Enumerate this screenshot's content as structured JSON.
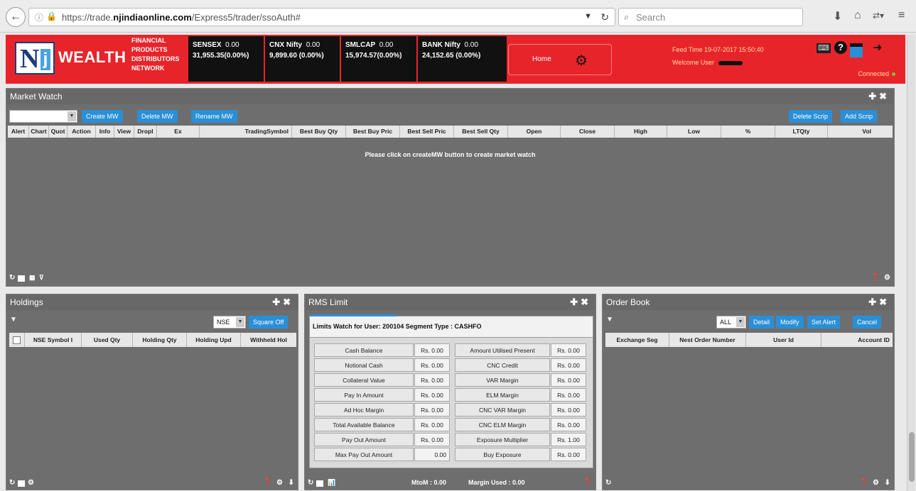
{
  "browser": {
    "url_prefix": "https://trade.",
    "url_domain": "njindiaonline.com",
    "url_path": "/Express5/trader/ssoAuth#",
    "search_placeholder": "Search"
  },
  "header": {
    "logo_letter": "N",
    "logo_j": "j",
    "brand": "WEALTH",
    "tagline": [
      "FINANCIAL",
      "PRODUCTS",
      "DISTRIBUTORS",
      "NETWORK"
    ],
    "indices": [
      {
        "name": "SENSEX",
        "change": "0.00",
        "value": "31,955.35(0.00%)"
      },
      {
        "name": "CNX Nifty",
        "change": "0.00",
        "value": "9,899.60 (0.00%)"
      },
      {
        "name": "SMLCAP",
        "change": "0.00",
        "value": "15,974.57(0.00%)"
      },
      {
        "name": "BANK Nifty",
        "change": "0.00",
        "value": "24,152.65 (0.00%)"
      }
    ],
    "home_label": "Home",
    "feed_time": "Feed Time 19-07-2017 15:50:40",
    "welcome": "Welcome User",
    "connected": "Connected"
  },
  "market_watch": {
    "title": "Market Watch",
    "buttons": {
      "create": "Create MW",
      "delete": "Delete MW",
      "rename": "Rename MW",
      "delete_scrip": "Delete Scrip",
      "add_scrip": "Add Scrip"
    },
    "columns": [
      "Alert",
      "Chart",
      "Quot",
      "Action",
      "Info",
      "View",
      "Dropl",
      "Ex",
      "TradingSymbol",
      "Best Buy Qty",
      "Best Buy Pric",
      "Best Sell Pric",
      "Best Sell Qty",
      "Open",
      "Close",
      "High",
      "Low",
      "%",
      "LTQty",
      "Vol"
    ],
    "message": "Please click on createMW button to create market watch"
  },
  "holdings": {
    "title": "Holdings",
    "exchange": "NSE",
    "square_off": "Square Off",
    "columns": [
      "NSE Symbol I",
      "Used Qty",
      "Holding Qty",
      "Holding Upd",
      "Withheld Hol"
    ]
  },
  "rms": {
    "title": "RMS Limit",
    "header": "Limits Watch for User: 200104 Segment Type : CASHFO",
    "rows": [
      [
        "Cash Balance",
        "Rs. 0.00",
        "Amount Utilised Present",
        "Rs. 0.00"
      ],
      [
        "Notional Cash",
        "Rs. 0.00",
        "CNC Credit",
        "Rs. 0.00"
      ],
      [
        "Collateral Value",
        "Rs. 0.00",
        "VAR Margin",
        "Rs. 0.00"
      ],
      [
        "Pay In Amount",
        "Rs. 0.00",
        "ELM Margin",
        "Rs. 0.00"
      ],
      [
        "Ad Hoc Margin",
        "Rs. 0.00",
        "CNC VAR Margin",
        "Rs. 0.00"
      ],
      [
        "Total Available Balance",
        "Rs. 0.00",
        "CNC ELM Margin",
        "Rs. 0.00"
      ],
      [
        "Pay Out Amount",
        "Rs. 0.00",
        "Exposure Multiplier",
        "Rs. 1.00"
      ],
      [
        "Max Pay Out Amount",
        "0.00",
        "Buy Exposure",
        "Rs. 0.00"
      ]
    ],
    "mtom": "MtoM : 0.00",
    "margin_used": "Margin Used : 0.00"
  },
  "order_book": {
    "title": "Order Book",
    "filter": "ALL",
    "buttons": {
      "detail": "Detail",
      "modify": "Modify",
      "set_alert": "Set Alert",
      "cancel": "Cancel"
    },
    "columns": [
      "Exchange Seg",
      "Nest Order Number",
      "User Id",
      "Account ID"
    ]
  },
  "colors": {
    "header_red": "#e8242b",
    "button_blue": "#2a8fd6",
    "panel_gray": "#6e6e6e"
  }
}
